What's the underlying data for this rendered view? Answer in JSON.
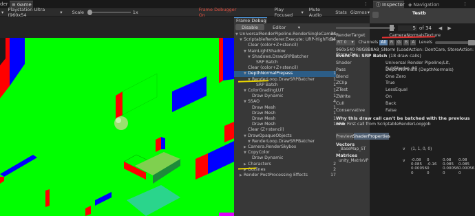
{
  "tabs": {
    "left_stub": "der",
    "game": "Game",
    "inspector": "Inspector",
    "navigation": "Navigation"
  },
  "game_toolbar": {
    "display_value": "Playstation Ultra (960x54",
    "scale_label": "Scale",
    "scale_value": "1x",
    "frame_debugger_status": "Frame Debugger On",
    "play_focused": "Play Focused",
    "mute_audio": "Mute Audio",
    "stats": "Stats",
    "gizmos": "Gizmos"
  },
  "frame_debug": {
    "tab_title": "Frame Debug",
    "disable_button": "Disable",
    "editor_dropdown": "Editor",
    "event_index": "5",
    "event_total": "of 34"
  },
  "inspector": {
    "title": "Testb"
  },
  "tree": [
    {
      "label": "UniversalRenderPipeline.RenderSingleCamera",
      "depth": 0,
      "arrow": "▼",
      "count": "34"
    },
    {
      "label": "ScriptableRenderer.Execute: URP-HighFidel",
      "depth": 1,
      "arrow": "▼",
      "count": "34"
    },
    {
      "label": "Clear (color+Z+stencil)",
      "depth": 2,
      "arrow": "",
      "count": ""
    },
    {
      "label": "MainLightShadow",
      "depth": 2,
      "arrow": "▼",
      "count": ""
    },
    {
      "label": "Shadows.DrawSRPBatcher",
      "depth": 3,
      "arrow": "▼",
      "count": ""
    },
    {
      "label": "SRP Batch",
      "depth": 4,
      "arrow": "",
      "count": ""
    },
    {
      "label": "Clear (color+Z+stencil)",
      "depth": 2,
      "arrow": "",
      "count": ""
    },
    {
      "label": "DepthNormalPrepass",
      "depth": 2,
      "arrow": "▼",
      "count": "1",
      "selected": true
    },
    {
      "label": "RenderLoop.DrawSRPBatcher",
      "depth": 3,
      "arrow": "▼",
      "count": "1"
    },
    {
      "label": "SRP Batch",
      "depth": 4,
      "arrow": "",
      "count": "1"
    },
    {
      "label": "ColorGradingLUT",
      "depth": 2,
      "arrow": "▼",
      "count": "1"
    },
    {
      "label": "Draw Dynamic",
      "depth": 3,
      "arrow": "",
      "count": "1"
    },
    {
      "label": "SSAO",
      "depth": 2,
      "arrow": "▼",
      "count": "4"
    },
    {
      "label": "Draw Mesh",
      "depth": 3,
      "arrow": "",
      "count": "1"
    },
    {
      "label": "Draw Mesh",
      "depth": 3,
      "arrow": "",
      "count": "1"
    },
    {
      "label": "Draw Mesh",
      "depth": 3,
      "arrow": "",
      "count": "1"
    },
    {
      "label": "Draw Mesh",
      "depth": 3,
      "arrow": "",
      "count": "1"
    },
    {
      "label": "Clear (Z+stencil)",
      "depth": 2,
      "arrow": "",
      "count": ""
    },
    {
      "label": "DrawOpaqueObjects",
      "depth": 2,
      "arrow": "▼",
      "count": ""
    },
    {
      "label": "RenderLoop.DrawSRPBatcher",
      "depth": 3,
      "arrow": "▼",
      "count": ""
    },
    {
      "label": "Camera.RenderSkybox",
      "depth": 2,
      "arrow": "▶",
      "count": ""
    },
    {
      "label": "CopyColor",
      "depth": 2,
      "arrow": "▼",
      "count": ""
    },
    {
      "label": "Draw Dynamic",
      "depth": 3,
      "arrow": "",
      "count": ""
    },
    {
      "label": "Characters",
      "depth": 2,
      "arrow": "▶",
      "count": "2"
    },
    {
      "label": "Outlines",
      "depth": 2,
      "arrow": "▶",
      "count": "2"
    },
    {
      "label": "Render PostProcessing Effects",
      "depth": 1,
      "arrow": "▶",
      "count": "17"
    }
  ],
  "details": {
    "render_target_label": "RenderTarget",
    "render_target_name": "_CameraNormalsTexture",
    "rt_dropdown": "RT 0",
    "channels_label": "Channels",
    "channel_buttons": [
      "All",
      "R",
      "G",
      "B",
      "A"
    ],
    "levels_label": "Levels",
    "format_line": "960x540 R8G8B8A8_SNorm (LoadAction: DontCare, StoreAction: Store, De",
    "event_title": "Event #5: SRP Batch",
    "event_calls": "(18 draw calls)",
    "properties": [
      {
        "key": "Shader",
        "value": "Universal Render Pipeline/Lit, SubShader #0"
      },
      {
        "key": "Pass",
        "value": "DepthNormals (DepthNormals)"
      },
      {
        "key": "Blend",
        "value": "One Zero"
      },
      {
        "key": "ZClip",
        "value": "True"
      },
      {
        "key": "ZTest",
        "value": "LessEqual"
      },
      {
        "key": "ZWrite",
        "value": "On"
      },
      {
        "key": "Cull",
        "value": "Back"
      },
      {
        "key": "Conservative",
        "value": "False"
      }
    ],
    "why_line": "Why this draw call can't be batched with the previous one",
    "srp_line": "SRP: First call from ScriptableRenderLoopJob",
    "preview_tab": "Preview",
    "shader_props_tab": "ShaderProperties",
    "vectors_header": "Vectors",
    "vector_name": "_BaseMap_ST",
    "vector_type": "v",
    "vector_value": "(1, 1, 0, 0)",
    "matrices_header": "Matrices",
    "matrix_name": "unity_MatrixVP",
    "matrix_type": "v",
    "matrix_cols": [
      [
        "-0.08",
        "0.085",
        "0.00056",
        "0"
      ],
      [
        "0",
        "-0.16",
        "0",
        "0"
      ],
      [
        "0.08",
        "0.085",
        "0.00056",
        "0"
      ],
      [
        "0.08",
        "0.085",
        "0.00056",
        "0"
      ]
    ]
  },
  "colors": {
    "scene_green": "#00ff00",
    "scene_red": "#ff0000",
    "scene_blue": "#0000ff",
    "selection_blue": "#2c5d87",
    "annotation_red": "#e03030",
    "annotation_yellow": "#e6d200"
  }
}
